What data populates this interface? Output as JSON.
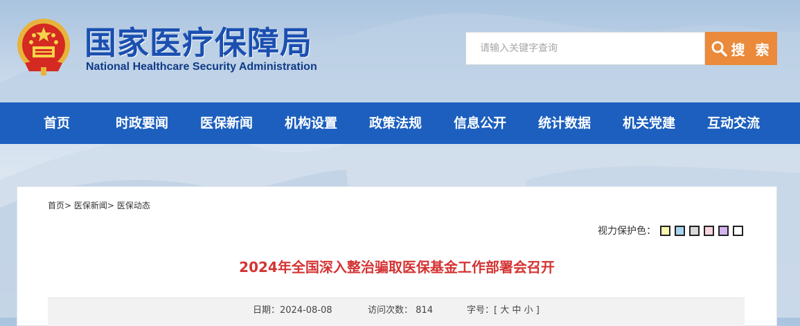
{
  "header": {
    "title": "国家医疗保障局",
    "subtitle": "National Healthcare Security Administration",
    "emblem_icon": "national-emblem-icon"
  },
  "search": {
    "placeholder": "请输入关键字查询",
    "button_label": "搜 索",
    "button_icon": "search-icon",
    "button_color": "#ea8a3a"
  },
  "nav": {
    "color": "#1c5fbe",
    "items": [
      {
        "label": "首页"
      },
      {
        "label": "时政要闻"
      },
      {
        "label": "医保新闻"
      },
      {
        "label": "机构设置"
      },
      {
        "label": "政策法规"
      },
      {
        "label": "信息公开"
      },
      {
        "label": "统计数据"
      },
      {
        "label": "机关党建"
      },
      {
        "label": "互动交流"
      }
    ]
  },
  "breadcrumb": {
    "items": [
      "首页",
      "医保新闻",
      "医保动态"
    ],
    "separator": ">"
  },
  "eye_care": {
    "label": "视力保护色：",
    "swatches": [
      "#faf5b0",
      "#a8d4f0",
      "#d9d9d9",
      "#f6d6dc",
      "#d2b4ee",
      "#ffffff"
    ]
  },
  "article": {
    "title": "2024年全国深入整治骗取医保基金工作部署会召开",
    "title_color": "#d43333",
    "date_label": "日期：",
    "date": "2024-08-08",
    "visits_label": "访问次数：",
    "visits": "814",
    "font_size_label": "字号：",
    "font_size_open": "[",
    "font_size_large": "大",
    "font_size_medium": "中",
    "font_size_small": "小",
    "font_size_close": "]"
  }
}
